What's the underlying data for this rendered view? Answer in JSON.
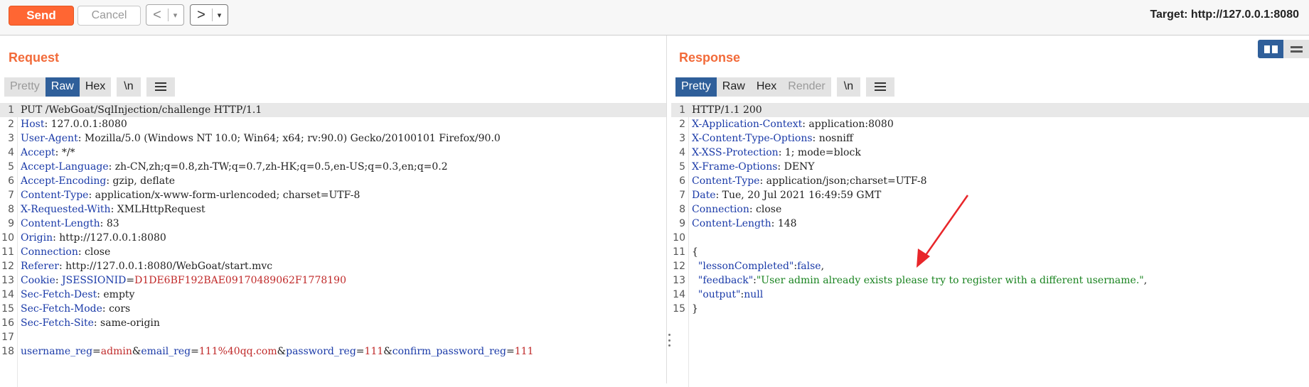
{
  "toolbar": {
    "send_label": "Send",
    "cancel_label": "Cancel",
    "back_arrow": "<",
    "forward_arrow": ">",
    "dropdown_glyph": "▾",
    "target_label": "Target: http://127.0.0.1:8080"
  },
  "request": {
    "title": "Request",
    "tabs": [
      "Pretty",
      "Raw",
      "Hex",
      "\\n"
    ],
    "active_tab": "Raw",
    "lines": [
      {
        "n": "1",
        "parts": [
          {
            "t": "PUT /WebGoat/SqlInjection/challenge HTTP/1.1",
            "c": "plain"
          }
        ]
      },
      {
        "n": "2",
        "parts": [
          {
            "t": "Host",
            "c": "hname"
          },
          {
            "t": ": 127.0.0.1:8080",
            "c": "plain"
          }
        ]
      },
      {
        "n": "3",
        "parts": [
          {
            "t": "User-Agent",
            "c": "hname"
          },
          {
            "t": ": Mozilla/5.0 (Windows NT 10.0; Win64; x64; rv:90.0) Gecko/20100101 Firefox/90.0",
            "c": "plain"
          }
        ]
      },
      {
        "n": "4",
        "parts": [
          {
            "t": "Accept",
            "c": "hname"
          },
          {
            "t": ": */*",
            "c": "plain"
          }
        ]
      },
      {
        "n": "5",
        "parts": [
          {
            "t": "Accept-Language",
            "c": "hname"
          },
          {
            "t": ": zh-CN,zh;q=0.8,zh-TW;q=0.7,zh-HK;q=0.5,en-US;q=0.3,en;q=0.2",
            "c": "plain"
          }
        ]
      },
      {
        "n": "6",
        "parts": [
          {
            "t": "Accept-Encoding",
            "c": "hname"
          },
          {
            "t": ": gzip, deflate",
            "c": "plain"
          }
        ]
      },
      {
        "n": "7",
        "parts": [
          {
            "t": "Content-Type",
            "c": "hname"
          },
          {
            "t": ": application/x-www-form-urlencoded; charset=UTF-8",
            "c": "plain"
          }
        ]
      },
      {
        "n": "8",
        "parts": [
          {
            "t": "X-Requested-With",
            "c": "hname"
          },
          {
            "t": ": XMLHttpRequest",
            "c": "plain"
          }
        ]
      },
      {
        "n": "9",
        "parts": [
          {
            "t": "Content-Length",
            "c": "hname"
          },
          {
            "t": ": 83",
            "c": "plain"
          }
        ]
      },
      {
        "n": "10",
        "parts": [
          {
            "t": "Origin",
            "c": "hname"
          },
          {
            "t": ": http://127.0.0.1:8080",
            "c": "plain"
          }
        ]
      },
      {
        "n": "11",
        "parts": [
          {
            "t": "Connection",
            "c": "hname"
          },
          {
            "t": ": close",
            "c": "plain"
          }
        ]
      },
      {
        "n": "12",
        "parts": [
          {
            "t": "Referer",
            "c": "hname"
          },
          {
            "t": ": http://127.0.0.1:8080/WebGoat/start.mvc",
            "c": "plain"
          }
        ]
      },
      {
        "n": "13",
        "parts": [
          {
            "t": "Cookie",
            "c": "hname"
          },
          {
            "t": ": ",
            "c": "plain"
          },
          {
            "t": "JSESSIONID",
            "c": "pname"
          },
          {
            "t": "=",
            "c": "plain"
          },
          {
            "t": "D1DE6BF192BAE09170489062F1778190",
            "c": "pval"
          }
        ]
      },
      {
        "n": "14",
        "parts": [
          {
            "t": "Sec-Fetch-Dest",
            "c": "hname"
          },
          {
            "t": ": empty",
            "c": "plain"
          }
        ]
      },
      {
        "n": "15",
        "parts": [
          {
            "t": "Sec-Fetch-Mode",
            "c": "hname"
          },
          {
            "t": ": cors",
            "c": "plain"
          }
        ]
      },
      {
        "n": "16",
        "parts": [
          {
            "t": "Sec-Fetch-Site",
            "c": "hname"
          },
          {
            "t": ": same-origin",
            "c": "plain"
          }
        ]
      },
      {
        "n": "17",
        "parts": []
      },
      {
        "n": "18",
        "parts": [
          {
            "t": "username_reg",
            "c": "pname"
          },
          {
            "t": "=",
            "c": "plain"
          },
          {
            "t": "admin",
            "c": "pval"
          },
          {
            "t": "&",
            "c": "plain"
          },
          {
            "t": "email_reg",
            "c": "pname"
          },
          {
            "t": "=",
            "c": "plain"
          },
          {
            "t": "111%40qq.com",
            "c": "pval"
          },
          {
            "t": "&",
            "c": "plain"
          },
          {
            "t": "password_reg",
            "c": "pname"
          },
          {
            "t": "=",
            "c": "plain"
          },
          {
            "t": "111",
            "c": "pval"
          },
          {
            "t": "&",
            "c": "plain"
          },
          {
            "t": "confirm_password_reg",
            "c": "pname"
          },
          {
            "t": "=",
            "c": "plain"
          },
          {
            "t": "111",
            "c": "pval"
          }
        ]
      }
    ]
  },
  "response": {
    "title": "Response",
    "tabs": [
      "Pretty",
      "Raw",
      "Hex",
      "Render",
      "\\n"
    ],
    "active_tab": "Pretty",
    "lines": [
      {
        "n": "1",
        "parts": [
          {
            "t": "HTTP/1.1 200",
            "c": "plain"
          }
        ]
      },
      {
        "n": "2",
        "parts": [
          {
            "t": "X-Application-Context",
            "c": "hname"
          },
          {
            "t": ": application:8080",
            "c": "plain"
          }
        ]
      },
      {
        "n": "3",
        "parts": [
          {
            "t": "X-Content-Type-Options",
            "c": "hname"
          },
          {
            "t": ": nosniff",
            "c": "plain"
          }
        ]
      },
      {
        "n": "4",
        "parts": [
          {
            "t": "X-XSS-Protection",
            "c": "hname"
          },
          {
            "t": ": 1; mode=block",
            "c": "plain"
          }
        ]
      },
      {
        "n": "5",
        "parts": [
          {
            "t": "X-Frame-Options",
            "c": "hname"
          },
          {
            "t": ": DENY",
            "c": "plain"
          }
        ]
      },
      {
        "n": "6",
        "parts": [
          {
            "t": "Content-Type",
            "c": "hname"
          },
          {
            "t": ": application/json;charset=UTF-8",
            "c": "plain"
          }
        ]
      },
      {
        "n": "7",
        "parts": [
          {
            "t": "Date",
            "c": "hname"
          },
          {
            "t": ": Tue, 20 Jul 2021 16:49:59 GMT",
            "c": "plain"
          }
        ]
      },
      {
        "n": "8",
        "parts": [
          {
            "t": "Connection",
            "c": "hname"
          },
          {
            "t": ": close",
            "c": "plain"
          }
        ]
      },
      {
        "n": "9",
        "parts": [
          {
            "t": "Content-Length",
            "c": "hname"
          },
          {
            "t": ": 148",
            "c": "plain"
          }
        ]
      },
      {
        "n": "10",
        "parts": []
      },
      {
        "n": "11",
        "parts": [
          {
            "t": "{",
            "c": "plain"
          }
        ]
      },
      {
        "n": "12",
        "parts": [
          {
            "t": "  ",
            "c": "plain"
          },
          {
            "t": "\"lessonCompleted\"",
            "c": "jkey"
          },
          {
            "t": ":",
            "c": "plain"
          },
          {
            "t": "false",
            "c": "jlit"
          },
          {
            "t": ",",
            "c": "plain"
          }
        ]
      },
      {
        "n": "13",
        "parts": [
          {
            "t": "  ",
            "c": "plain"
          },
          {
            "t": "\"feedback\"",
            "c": "jkey"
          },
          {
            "t": ":",
            "c": "plain"
          },
          {
            "t": "\"User admin already exists please try to register with a different username.\"",
            "c": "jstr"
          },
          {
            "t": ",",
            "c": "plain"
          }
        ]
      },
      {
        "n": "14",
        "parts": [
          {
            "t": "  ",
            "c": "plain"
          },
          {
            "t": "\"output\"",
            "c": "jkey"
          },
          {
            "t": ":",
            "c": "plain"
          },
          {
            "t": "null",
            "c": "jlit"
          }
        ]
      },
      {
        "n": "15",
        "parts": [
          {
            "t": "}",
            "c": "plain"
          }
        ]
      }
    ]
  },
  "annotation": {
    "arrow_color": "#e8262a"
  },
  "colors": {
    "accent": "#ff6633",
    "active_tab": "#2f5f9a",
    "title": "#f26b3a"
  }
}
